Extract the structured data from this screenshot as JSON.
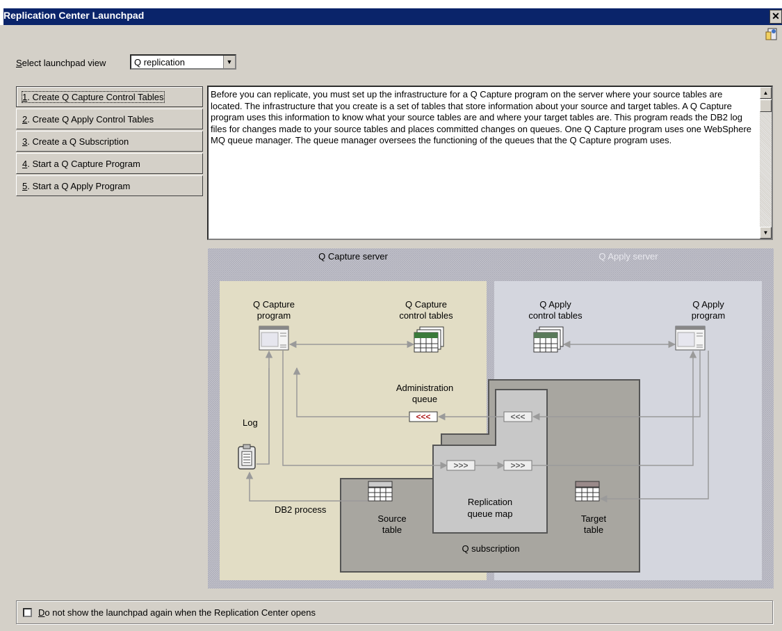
{
  "window": {
    "title": "Replication Center Launchpad",
    "close_glyph": "✕"
  },
  "view_select": {
    "label": "Select launchpad view",
    "label_accel": "S",
    "label_rest": "elect launchpad view",
    "value": "Q replication"
  },
  "steps": [
    {
      "num": "1",
      "label": ". Create Q Capture Control Tables"
    },
    {
      "num": "2",
      "label": ". Create Q Apply Control Tables"
    },
    {
      "num": "3",
      "label": ". Create a Q Subscription"
    },
    {
      "num": "4",
      "label": ". Start a Q Capture Program"
    },
    {
      "num": "5",
      "label": ". Start a Q Apply Program"
    }
  ],
  "description": "Before you can replicate, you must set up the infrastructure for a Q Capture program on the server where your source tables are located. The infrastructure that you create is a set of tables that store information about your source and target tables. A Q Capture program uses this information to know what your source tables are and where your target tables are. This program reads the DB2 log files for changes made to your source tables and places committed changes on queues. One Q Capture program uses one WebSphere MQ queue manager. The queue manager oversees the functioning of the queues that the Q Capture program uses.",
  "diagram": {
    "capture_server": "Q Capture server",
    "apply_server": "Q Apply server",
    "capture_program": [
      "Q Capture",
      "program"
    ],
    "capture_tables": [
      "Q Capture",
      "control tables"
    ],
    "apply_tables": [
      "Q Apply",
      "control tables"
    ],
    "apply_program": [
      "Q Apply",
      "program"
    ],
    "admin_queue": [
      "Administration",
      "queue"
    ],
    "log": "Log",
    "db2_process": "DB2 process",
    "source_table": [
      "Source",
      "table"
    ],
    "queue_map": [
      "Replication",
      "queue map"
    ],
    "target_table": [
      "Target",
      "table"
    ],
    "subscription": "Q subscription",
    "colors": {
      "capture_bg": "#e2ddc5",
      "apply_bg": "#d4d6de",
      "subscription_bg": "#a8a6a0",
      "map_bg": "#c8c8c8"
    }
  },
  "footer": {
    "accel": "D",
    "rest": "o not show the launchpad again when the Replication Center opens",
    "checked": false
  }
}
